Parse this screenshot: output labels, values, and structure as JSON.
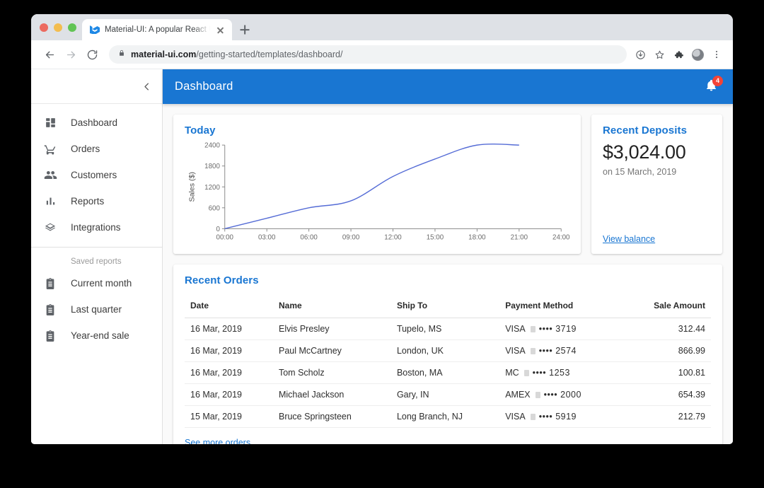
{
  "browser": {
    "tab": {
      "title": "Material-UI: A popular React U",
      "favicon": "material-ui-favicon"
    },
    "newtab_label": "+",
    "url_domain": "material-ui.com",
    "url_path": "/getting-started/templates/dashboard/",
    "nav": {
      "back": "back-arrow",
      "forward": "forward-arrow",
      "reload": "reload-icon"
    },
    "tools": [
      "install-icon",
      "bookmark-star-icon",
      "extensions-icon",
      "profile-avatar",
      "more-menu-icon"
    ]
  },
  "drawer": {
    "collapse_label": "chevron-left-icon",
    "items": [
      {
        "label": "Dashboard",
        "icon": "dashboard-icon"
      },
      {
        "label": "Orders",
        "icon": "shopping-cart-icon"
      },
      {
        "label": "Customers",
        "icon": "people-icon"
      },
      {
        "label": "Reports",
        "icon": "bar-chart-icon"
      },
      {
        "label": "Integrations",
        "icon": "layers-icon"
      }
    ],
    "saved_reports_caption": "Saved reports",
    "saved_reports": [
      {
        "label": "Current month",
        "icon": "assignment-icon"
      },
      {
        "label": "Last quarter",
        "icon": "assignment-icon"
      },
      {
        "label": "Year-end sale",
        "icon": "assignment-icon"
      }
    ]
  },
  "appbar": {
    "title": "Dashboard",
    "accent_color": "#1976d2",
    "notifications_icon": "notifications-bell-icon",
    "notifications_count": "4",
    "badge_color": "#f44336"
  },
  "deposits": {
    "title": "Recent Deposits",
    "amount": "$3,024.00",
    "date": "on 15 March, 2019",
    "link": "View balance"
  },
  "orders": {
    "title": "Recent Orders",
    "columns": [
      "Date",
      "Name",
      "Ship To",
      "Payment Method",
      "Sale Amount"
    ],
    "rows": [
      {
        "date": "16 Mar, 2019",
        "name": "Elvis Presley",
        "ship_to": "Tupelo, MS",
        "brand": "VISA",
        "dots": "••••",
        "last4": "3719",
        "amount": "312.44"
      },
      {
        "date": "16 Mar, 2019",
        "name": "Paul McCartney",
        "ship_to": "London, UK",
        "brand": "VISA",
        "dots": "••••",
        "last4": "2574",
        "amount": "866.99"
      },
      {
        "date": "16 Mar, 2019",
        "name": "Tom Scholz",
        "ship_to": "Boston, MA",
        "brand": "MC",
        "dots": "••••",
        "last4": "1253",
        "amount": "100.81"
      },
      {
        "date": "16 Mar, 2019",
        "name": "Michael Jackson",
        "ship_to": "Gary, IN",
        "brand": "AMEX",
        "dots": "••••",
        "last4": "2000",
        "amount": "654.39"
      },
      {
        "date": "15 Mar, 2019",
        "name": "Bruce Springsteen",
        "ship_to": "Long Branch, NJ",
        "brand": "VISA",
        "dots": "••••",
        "last4": "5919",
        "amount": "212.79"
      }
    ],
    "see_more": "See more orders"
  },
  "chart_data": {
    "type": "line",
    "title": "Today",
    "xlabel": "",
    "ylabel": "Sales ($)",
    "line_color": "#556cd6",
    "grid": false,
    "legend": "none",
    "x_ticks": [
      "00:00",
      "03:00",
      "06:00",
      "09:00",
      "12:00",
      "15:00",
      "18:00",
      "21:00",
      "24:00"
    ],
    "y_ticks": [
      0,
      600,
      1200,
      1800,
      2400
    ],
    "ylim": [
      0,
      2400
    ],
    "xlim": [
      0,
      24
    ],
    "x": [
      0,
      3,
      6,
      9,
      12,
      15,
      18,
      21
    ],
    "values": [
      0,
      300,
      600,
      800,
      1500,
      2000,
      2400,
      2400
    ]
  }
}
